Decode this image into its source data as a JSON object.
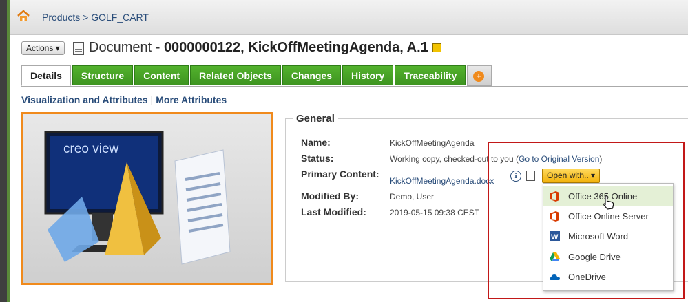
{
  "breadcrumb": {
    "text": "Products > GOLF_CART"
  },
  "actions_button": {
    "label": "Actions"
  },
  "title": {
    "prefix": "Document - ",
    "bold": "0000000122, KickOffMeetingAgenda, A.1"
  },
  "tabs": [
    {
      "label": "Details"
    },
    {
      "label": "Structure"
    },
    {
      "label": "Content"
    },
    {
      "label": "Related Objects"
    },
    {
      "label": "Changes"
    },
    {
      "label": "History"
    },
    {
      "label": "Traceability"
    }
  ],
  "sublinks": {
    "visualization": "Visualization and Attributes",
    "more": "More Attributes"
  },
  "thumbnail": {
    "text": "creo view"
  },
  "general": {
    "title": "General",
    "name_label": "Name:",
    "name_value": "KickOffMeetingAgenda",
    "status_label": "Status:",
    "status_value": "Working copy, checked-out to you (",
    "status_link": "Go to Original Version",
    "status_end": ")",
    "primary_label": "Primary Content:",
    "primary_value": "KickOffMeetingAgenda.docx",
    "modified_by_label": "Modified By:",
    "modified_by_value": "Demo, User",
    "last_modified_label": "Last Modified:",
    "last_modified_value": "2019-05-15 09:38 CEST"
  },
  "open_with": {
    "label": "Open with..",
    "items": [
      {
        "label": "Office 365 Online",
        "icon": "office-icon"
      },
      {
        "label": "Office Online Server",
        "icon": "office-icon"
      },
      {
        "label": "Microsoft Word",
        "icon": "word-icon"
      },
      {
        "label": "Google Drive",
        "icon": "google-drive-icon"
      },
      {
        "label": "OneDrive",
        "icon": "onedrive-icon"
      }
    ]
  },
  "colors": {
    "tab_green": "#3d9320",
    "highlight_orange": "#f08a1c",
    "annotation_red": "#c21818"
  }
}
